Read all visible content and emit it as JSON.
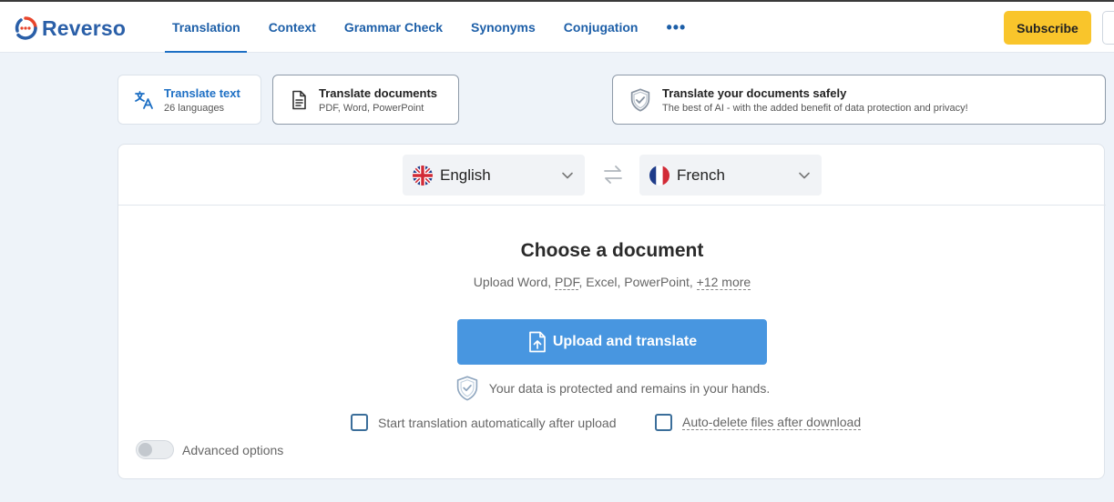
{
  "brand": {
    "name": "Reverso"
  },
  "nav": {
    "items": [
      {
        "label": "Translation",
        "active": true
      },
      {
        "label": "Context",
        "active": false
      },
      {
        "label": "Grammar Check",
        "active": false
      },
      {
        "label": "Synonyms",
        "active": false
      },
      {
        "label": "Conjugation",
        "active": false
      }
    ],
    "more": "•••"
  },
  "header": {
    "subscribe_label": "Subscribe"
  },
  "modes": {
    "text": {
      "title": "Translate text",
      "subtitle": "26 languages"
    },
    "documents": {
      "title": "Translate documents",
      "subtitle": "PDF, Word, PowerPoint"
    },
    "safe": {
      "title": "Translate your documents safely",
      "subtitle": "The best of AI - with the added benefit of data protection and privacy!"
    }
  },
  "languages": {
    "source": "English",
    "target": "French"
  },
  "upload": {
    "title": "Choose a document",
    "formats_prefix": "Upload Word, ",
    "formats_pdf": "PDF",
    "formats_middle": ", Excel, PowerPoint, ",
    "formats_more": "+12 more",
    "button_label": "Upload and translate",
    "protected_text": "Your data is protected and remains in your hands."
  },
  "options": {
    "auto_start": {
      "label": "Start translation automatically after upload",
      "checked": false
    },
    "auto_delete": {
      "label": "Auto-delete files after download",
      "checked": false
    },
    "advanced": {
      "label": "Advanced options",
      "enabled": false
    }
  },
  "colors": {
    "brand_blue": "#2a5fa8",
    "nav_blue": "#1d5fa8",
    "subscribe_yellow": "#f9c52b",
    "upload_blue": "#4896e0",
    "page_bg": "#eef3f9"
  }
}
